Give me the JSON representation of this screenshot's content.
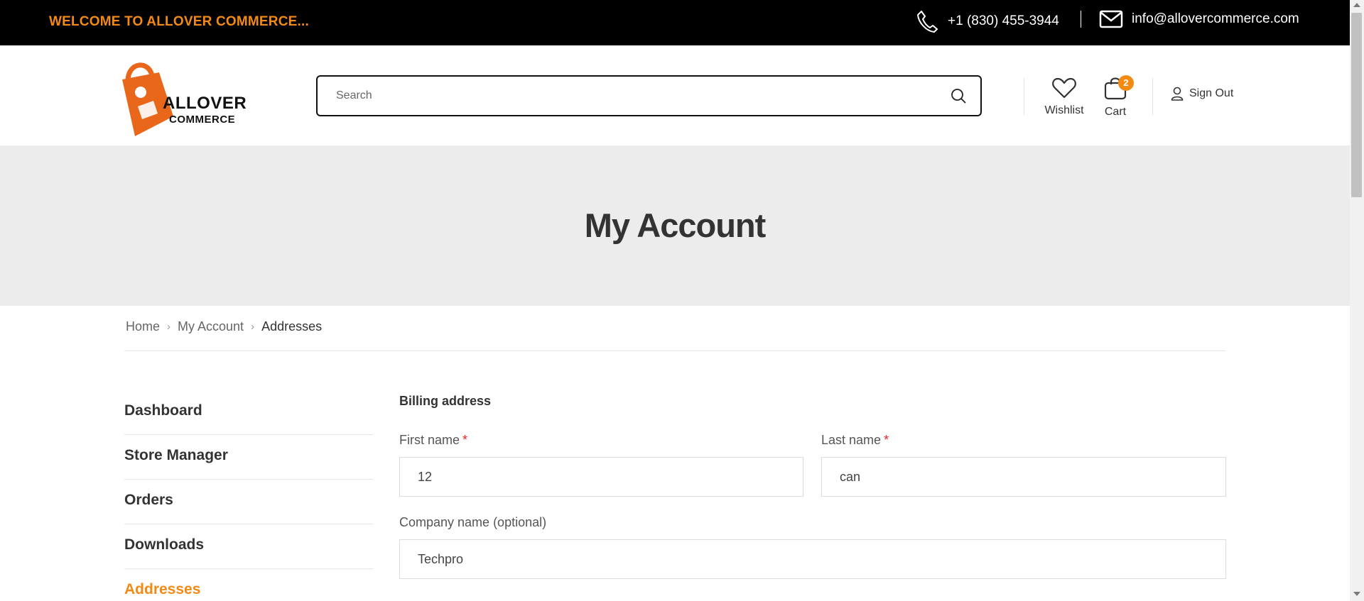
{
  "topbar": {
    "welcome": "WELCOME TO ALLOVER COMMERCE...",
    "phone": "+1 (830) 455-3944",
    "email": "info@allovercommerce.com"
  },
  "header": {
    "logo_line1": "ALLOVER",
    "logo_line2": "COMMERCE",
    "search_placeholder": "Search",
    "wishlist_label": "Wishlist",
    "cart_label": "Cart",
    "cart_count": "2",
    "signout_label": "Sign Out"
  },
  "banner": {
    "title": "My Account"
  },
  "breadcrumb": {
    "items": [
      "Home",
      "My Account",
      "Addresses"
    ]
  },
  "sidebar": {
    "items": [
      {
        "label": "Dashboard"
      },
      {
        "label": "Store Manager"
      },
      {
        "label": "Orders"
      },
      {
        "label": "Downloads"
      },
      {
        "label": "Addresses"
      }
    ],
    "active": "Addresses"
  },
  "form": {
    "heading": "Billing address",
    "first_name": {
      "label": "First name",
      "required": "*",
      "value": "12"
    },
    "last_name": {
      "label": "Last name",
      "required": "*",
      "value": "can"
    },
    "company": {
      "label": "Company name (optional)",
      "value": "Techpro"
    }
  },
  "colors": {
    "accent": "#f38a14",
    "topbar_bg": "#000000",
    "banner_bg": "#ececec",
    "required": "#ee2222"
  }
}
